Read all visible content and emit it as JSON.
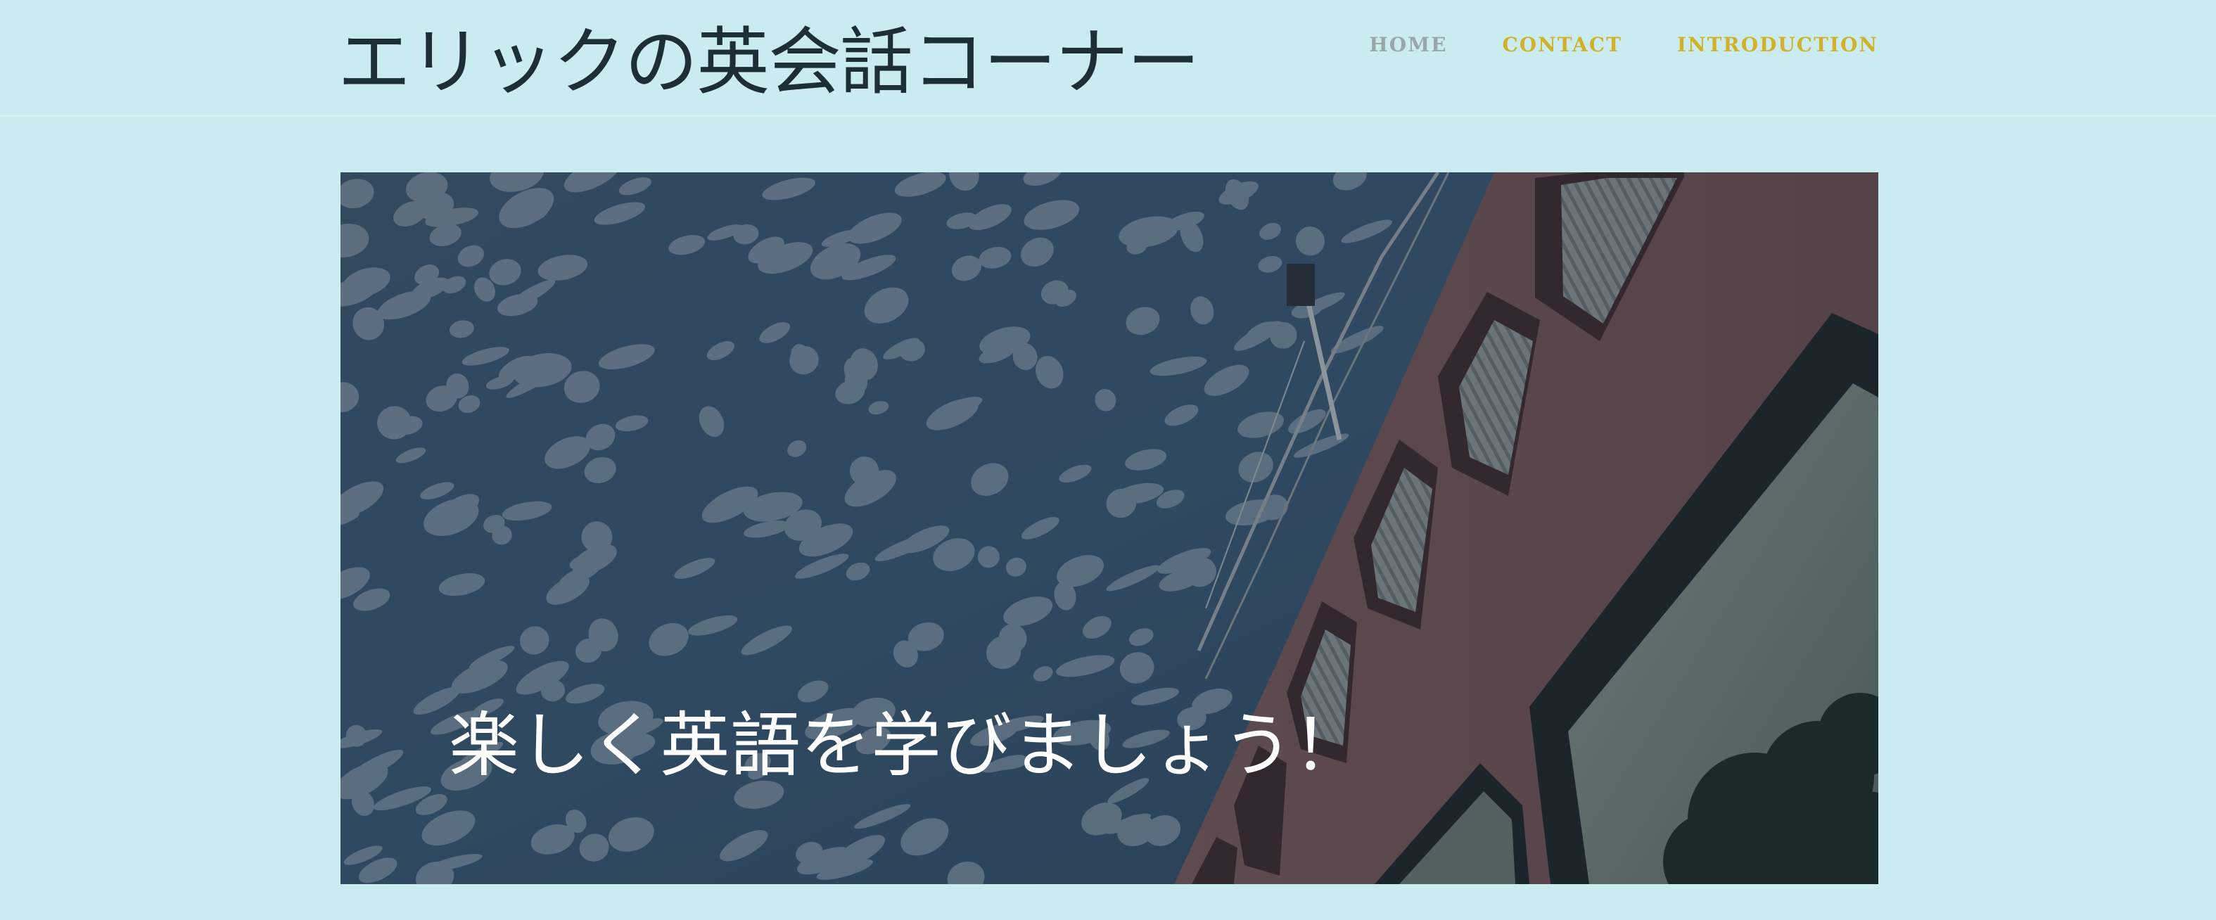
{
  "header": {
    "site_title": "エリックの英会話コーナー",
    "nav": [
      {
        "label": "HOME",
        "color": "#9aa7a9"
      },
      {
        "label": "CONTACT",
        "color": "#d1b12c"
      },
      {
        "label": "INTRODUCTION",
        "color": "#d1b12c"
      }
    ]
  },
  "hero": {
    "caption": "楽しく英語を学びましょう！",
    "image_description_icon": "sky-and-brick-building-photo"
  },
  "colors": {
    "page_background": "#cbecee",
    "title_text": "#1d2f35",
    "accent": "#d1b12c",
    "nav_inactive": "#9aa7a9"
  }
}
